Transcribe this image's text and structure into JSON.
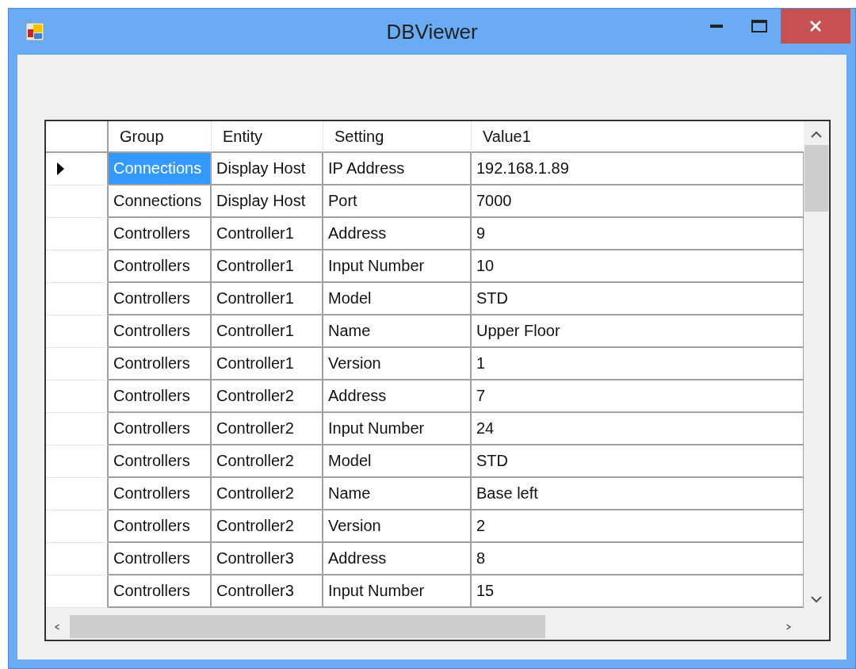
{
  "window": {
    "title": "DBViewer"
  },
  "table": {
    "columns": [
      "Group",
      "Entity",
      "Setting",
      "Value1"
    ],
    "rows": [
      {
        "selected": true,
        "cells": [
          "Connections",
          "Display Host",
          "IP Address",
          "192.168.1.89"
        ]
      },
      {
        "selected": false,
        "cells": [
          "Connections",
          "Display Host",
          "Port",
          "7000"
        ]
      },
      {
        "selected": false,
        "cells": [
          "Controllers",
          "Controller1",
          "Address",
          "9"
        ]
      },
      {
        "selected": false,
        "cells": [
          "Controllers",
          "Controller1",
          "Input Number",
          "10"
        ]
      },
      {
        "selected": false,
        "cells": [
          "Controllers",
          "Controller1",
          "Model",
          "STD"
        ]
      },
      {
        "selected": false,
        "cells": [
          "Controllers",
          "Controller1",
          "Name",
          "Upper Floor"
        ]
      },
      {
        "selected": false,
        "cells": [
          "Controllers",
          "Controller1",
          "Version",
          "1"
        ]
      },
      {
        "selected": false,
        "cells": [
          "Controllers",
          "Controller2",
          "Address",
          "7"
        ]
      },
      {
        "selected": false,
        "cells": [
          "Controllers",
          "Controller2",
          "Input Number",
          "24"
        ]
      },
      {
        "selected": false,
        "cells": [
          "Controllers",
          "Controller2",
          "Model",
          "STD"
        ]
      },
      {
        "selected": false,
        "cells": [
          "Controllers",
          "Controller2",
          "Name",
          "Base left"
        ]
      },
      {
        "selected": false,
        "cells": [
          "Controllers",
          "Controller2",
          "Version",
          "2"
        ]
      },
      {
        "selected": false,
        "cells": [
          "Controllers",
          "Controller3",
          "Address",
          "8"
        ]
      },
      {
        "selected": false,
        "cells": [
          "Controllers",
          "Controller3",
          "Input Number",
          "15"
        ]
      }
    ]
  }
}
